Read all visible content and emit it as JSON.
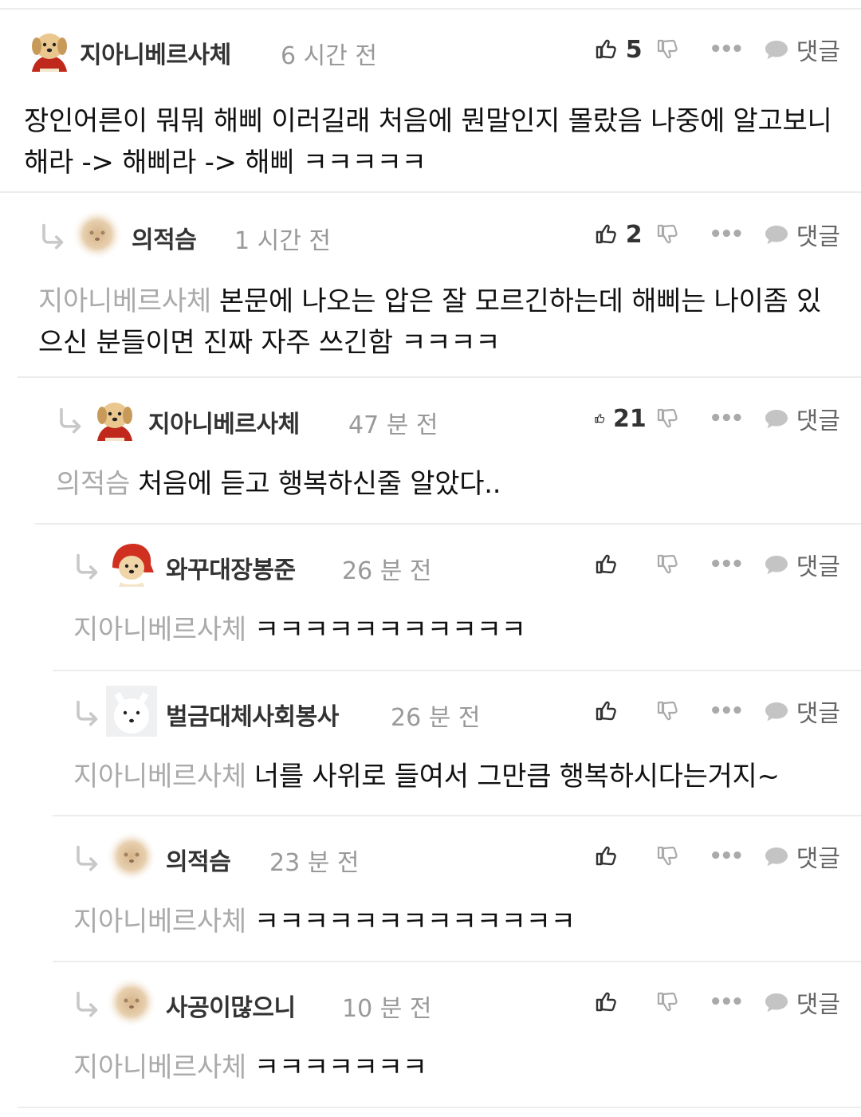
{
  "ui": {
    "reply_label": "댓글"
  },
  "comments": [
    {
      "nickname": "지아니베르사체",
      "time": "6 시간 전",
      "likes": "5",
      "mention": "",
      "text": "장인어른이 뭐뭐 해삐 이러길래 처음에 뭔말인지 몰랐음 나중에 알고보니 해라 -> 해삐라 -> 해삐 ㅋㅋㅋㅋㅋ",
      "avatar_icon": "puppy-red-cape-icon"
    },
    {
      "nickname": "의적슴",
      "time": "1 시간 전",
      "likes": "2",
      "mention": "지아니베르사체",
      "text": "본문에 나오는 압은 잘 모르긴하는데 해삐는 나이좀 있으신 분들이면 진짜 자주 쓰긴함 ㅋㅋㅋㅋ",
      "avatar_icon": "blurred-puppy-icon"
    },
    {
      "nickname": "지아니베르사체",
      "time": "47 분 전",
      "likes": "21",
      "mention": "의적슴",
      "text": "처음에 듣고 행복하신줄 알았다..",
      "avatar_icon": "puppy-red-cape-icon"
    },
    {
      "nickname": "와꾸대장봉준",
      "time": "26 분 전",
      "likes": "",
      "mention": "지아니베르사체",
      "text": "ㅋㅋㅋㅋㅋㅋㅋㅋㅋㅋㅋ",
      "avatar_icon": "puppy-red-hood-icon"
    },
    {
      "nickname": "벌금대체사회봉사",
      "time": "26 분 전",
      "likes": "",
      "mention": "지아니베르사체",
      "text": "너를 사위로 들여서 그만큼 행복하시다는거지~",
      "avatar_icon": "white-fox-icon"
    },
    {
      "nickname": "의적슴",
      "time": "23 분 전",
      "likes": "",
      "mention": "지아니베르사체",
      "text": "ㅋㅋㅋㅋㅋㅋㅋㅋㅋㅋㅋㅋㅋ",
      "avatar_icon": "blurred-puppy-icon"
    },
    {
      "nickname": "사공이많으니",
      "time": "10 분 전",
      "likes": "",
      "mention": "지아니베르사체",
      "text": "ㅋㅋㅋㅋㅋㅋㅋ",
      "avatar_icon": "blurred-puppy-icon"
    }
  ]
}
